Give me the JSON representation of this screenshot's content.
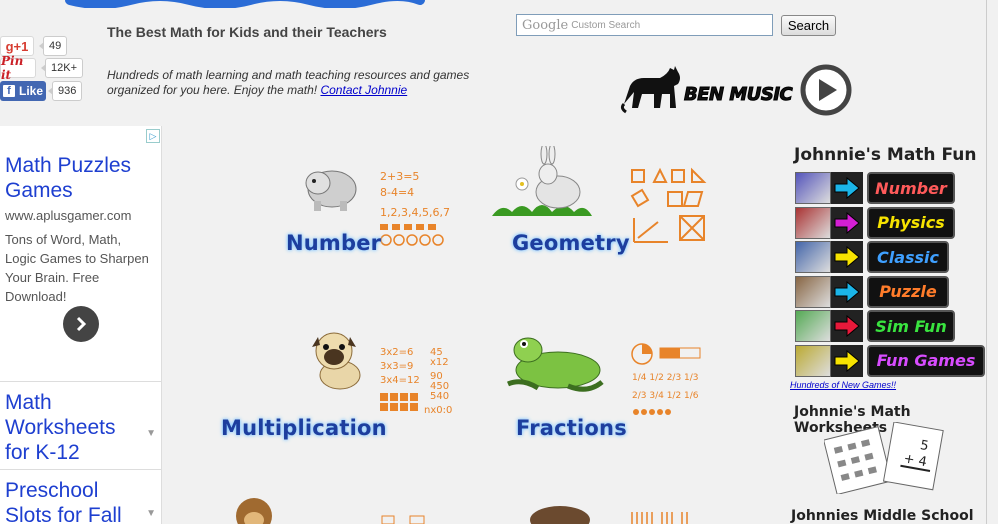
{
  "header": {
    "tagline": "The Best Math for Kids and their Teachers",
    "intro": "Hundreds of math learning and math teaching resources and games organized for you here. Enjoy the math!",
    "contact_link": "Contact Johnnie"
  },
  "social": {
    "gplus_label": "g+1",
    "gplus_count": "49",
    "pinit_label": "Pin it",
    "pinit_count": "12K+",
    "like_label": "Like",
    "like_count": "936"
  },
  "search": {
    "brand": "Google",
    "placeholder": "Custom Search",
    "button": "Search"
  },
  "ben_music": {
    "label": "BEN MUSIC"
  },
  "ad": {
    "title": "Math Puzzles Games",
    "url": "www.aplusgamer.com",
    "description": "Tons of Word, Math, Logic Games to Sharpen Your Brain. Free Download!",
    "links": [
      "Math Worksheets for K-12",
      "Preschool Slots for Fall"
    ]
  },
  "categories": [
    {
      "label": "Number"
    },
    {
      "label": "Geometry"
    },
    {
      "label": "Multiplication"
    },
    {
      "label": "Fractions"
    }
  ],
  "math_fun": {
    "title": "Johnnie's Math Fun",
    "items": [
      {
        "label": "Number",
        "color": "#ff5a5a",
        "arrow": "#1bb5e8"
      },
      {
        "label": "Physics",
        "color": "#f7e300",
        "arrow": "#d41fd4"
      },
      {
        "label": "Classic",
        "color": "#3fa0ff",
        "arrow": "#f7e300"
      },
      {
        "label": "Puzzle",
        "color": "#ff7c2a",
        "arrow": "#1bb5e8"
      },
      {
        "label": "Sim Fun",
        "color": "#39e33f",
        "arrow": "#e8193a"
      },
      {
        "label": "Fun Games",
        "color": "#d84cff",
        "arrow": "#f7e300"
      }
    ],
    "more_link": "Hundreds of New Games!!"
  },
  "worksheets": {
    "title": "Johnnie's Math Worksheets"
  },
  "middle_school": {
    "title": "Johnnies Middle School Math"
  }
}
